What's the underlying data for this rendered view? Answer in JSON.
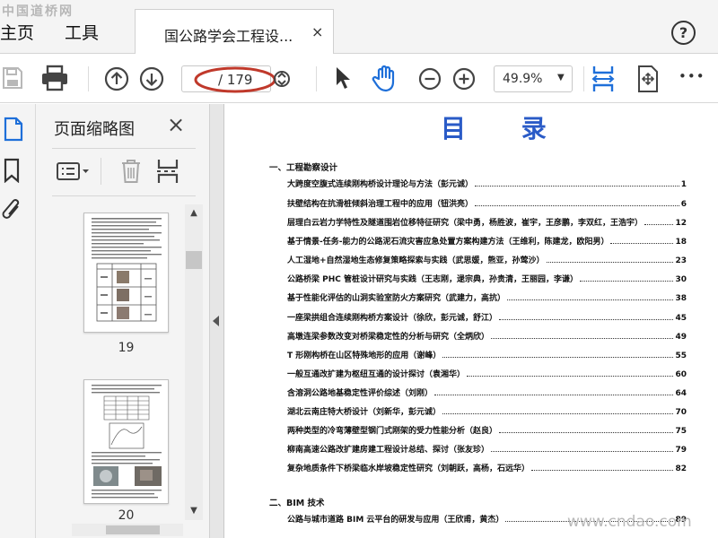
{
  "tabbar": {
    "home_label": "主页",
    "tools_label": "工具",
    "doc_tab_title": "国公路学会工程设...",
    "close_glyph": "×",
    "help_glyph": "?"
  },
  "toolbar": {
    "page_current": "",
    "page_total": "/ 179",
    "zoom_value": "49.9%",
    "more_glyph": "•••"
  },
  "thumbnails": {
    "title": "页面缩略图",
    "close_glyph": "×",
    "pages": [
      {
        "label": "19"
      },
      {
        "label": "20"
      }
    ]
  },
  "document": {
    "title": "目 录",
    "sections": [
      {
        "heading": "一、工程勘察设计",
        "entries": [
          {
            "title": "大跨度空腹式连续刚构桥设计理论与方法（彭元诚）",
            "page": "1"
          },
          {
            "title": "扶壁结构在抗滑桩倾斜治理工程中的应用（钮洪亮）",
            "page": "6"
          },
          {
            "title": "层理白云岩力学特性及隧道围岩位移特征研究（梁中勇，杨胜波，崔宇，王彦鹏，李双红，王浩宇）",
            "page": "12"
          },
          {
            "title": "基于情景-任务-能力的公路泥石流灾害应急处置方案构建方法（王维利，陈建龙，欧阳男）",
            "page": "18"
          },
          {
            "title": "人工湿地+自然湿地生态修复策略探索与实践（武思媛，熊亚，孙莺沙）",
            "page": "23"
          },
          {
            "title": "公路桥梁 PHC 管桩设计研究与实践（王志刚，逯宗典，孙贵清，王丽园，李谦）",
            "page": "30"
          },
          {
            "title": "基于性能化评估的山洞实验室防火方案研究（武建力，高抗）",
            "page": "38"
          },
          {
            "title": "一座梁拱组合连续刚构桥方案设计（徐欣，彭元诚，舒江）",
            "page": "45"
          },
          {
            "title": "高墩连梁参数改变对桥梁稳定性的分析与研究（全炳欣）",
            "page": "49"
          },
          {
            "title": "T 形刚构桥在山区特殊地形的应用（谢峰）",
            "page": "55"
          },
          {
            "title": "一般互通改扩建为枢纽互通的设计探讨（袁湘华）",
            "page": "60"
          },
          {
            "title": "含溶洞公路地基稳定性评价综述（刘刚）",
            "page": "64"
          },
          {
            "title": "湖北云南庄特大桥设计（刘新华，彭元诚）",
            "page": "70"
          },
          {
            "title": "两种类型的冷弯薄壁型钢门式刚架的受力性能分析（赵良）",
            "page": "75"
          },
          {
            "title": "柳南高速公路改扩建房建工程设计总结、探讨（张友珍）",
            "page": "79"
          },
          {
            "title": "复杂地质条件下桥梁临水岸坡稳定性研究（刘朝跃，高杨，石远华）",
            "page": "82"
          }
        ]
      },
      {
        "heading": "二、BIM 技术",
        "entries": [
          {
            "title": "公路与城市道路 BIM 云平台的研发与应用（王欣甫，黄杰）",
            "page": "89"
          }
        ]
      }
    ]
  },
  "watermarks": {
    "top_left": "中国道桥网",
    "bottom_right": "www.cndao.com"
  },
  "colors": {
    "toc_title": "#2a5bc7",
    "hand_tool": "#1e6fd9",
    "annotation_ring": "#c0392b"
  }
}
